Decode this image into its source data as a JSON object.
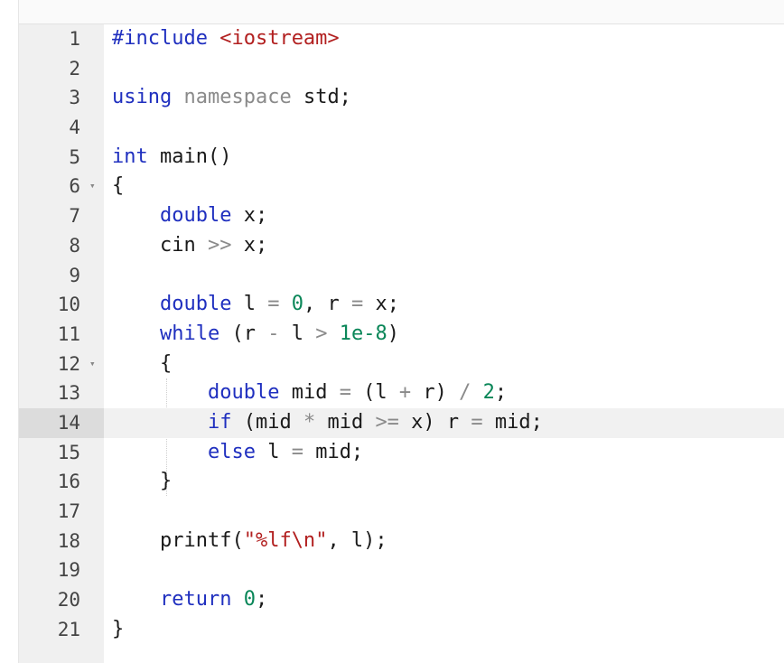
{
  "editor": {
    "active_line": 14,
    "foldable_lines": [
      6,
      12
    ],
    "lines": [
      {
        "n": "1",
        "code": "#include <iostream>"
      },
      {
        "n": "2",
        "code": ""
      },
      {
        "n": "3",
        "code": "using namespace std;"
      },
      {
        "n": "4",
        "code": ""
      },
      {
        "n": "5",
        "code": "int main()"
      },
      {
        "n": "6",
        "code": "{"
      },
      {
        "n": "7",
        "code": "    double x;"
      },
      {
        "n": "8",
        "code": "    cin >> x;"
      },
      {
        "n": "9",
        "code": ""
      },
      {
        "n": "10",
        "code": "    double l = 0, r = x;"
      },
      {
        "n": "11",
        "code": "    while (r - l > 1e-8)"
      },
      {
        "n": "12",
        "code": "    {"
      },
      {
        "n": "13",
        "code": "        double mid = (l + r) / 2;"
      },
      {
        "n": "14",
        "code": "        if (mid * mid >= x) r = mid;"
      },
      {
        "n": "15",
        "code": "        else l = mid;"
      },
      {
        "n": "16",
        "code": "    }"
      },
      {
        "n": "17",
        "code": ""
      },
      {
        "n": "18",
        "code": "    printf(\"%lf\\n\", l);"
      },
      {
        "n": "19",
        "code": ""
      },
      {
        "n": "20",
        "code": "    return 0;"
      },
      {
        "n": "21",
        "code": "}"
      }
    ]
  },
  "icons": {
    "fold": "chevron-down-icon"
  },
  "colors": {
    "keyword": "#1f2fbf",
    "string": "#b22020",
    "number": "#098658",
    "operator": "#8a8a8a",
    "gutter": "#f0f0f0",
    "active_line": "#f1f1f1"
  }
}
